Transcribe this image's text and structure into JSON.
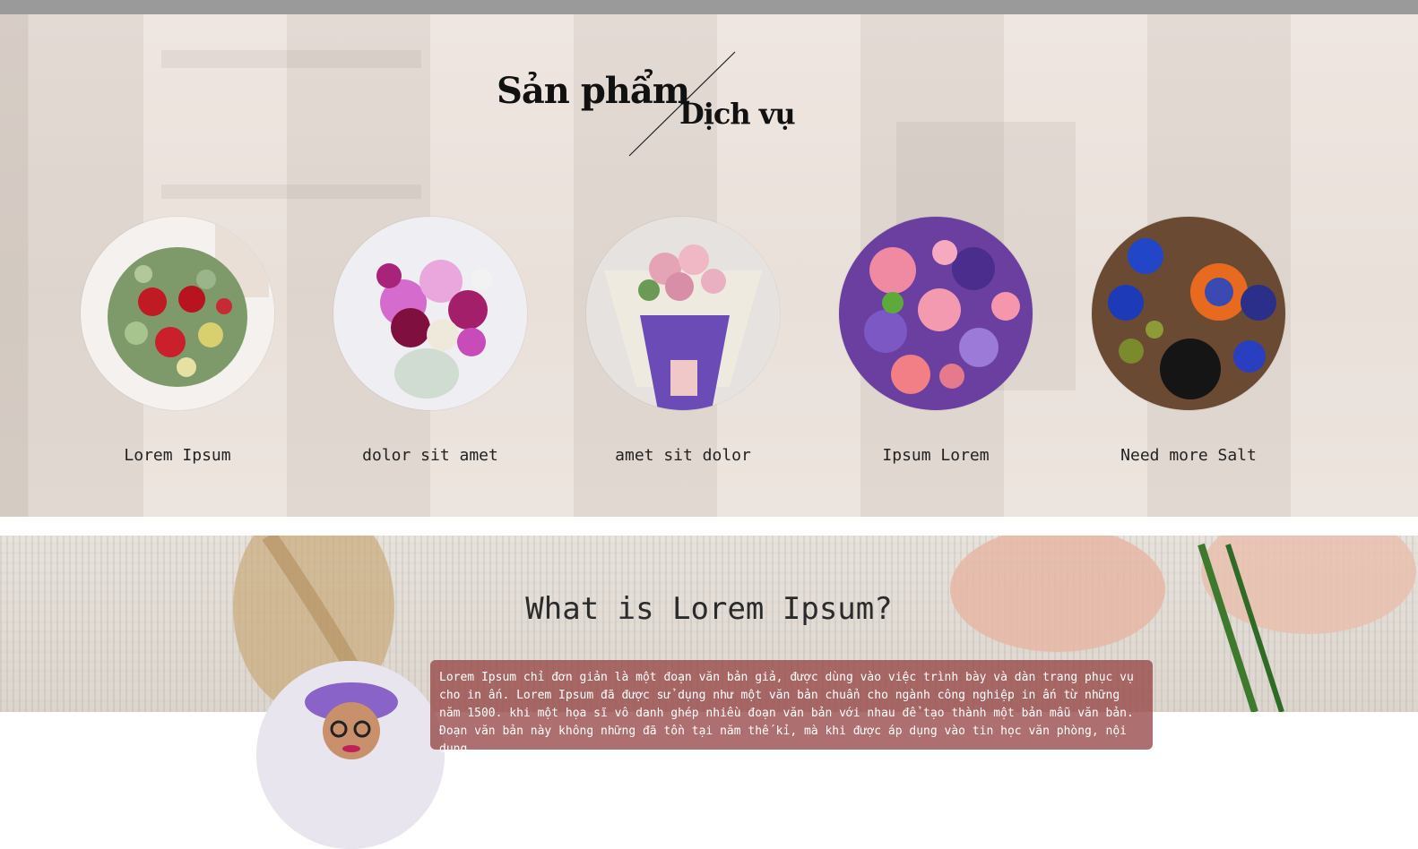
{
  "products_section": {
    "title_main": "Sản phẩm",
    "title_sub": "Dịch vụ",
    "items": [
      {
        "label": "Lorem Ipsum"
      },
      {
        "label": "dolor sit amet"
      },
      {
        "label": "amet sit dolor"
      },
      {
        "label": "Ipsum Lorem"
      },
      {
        "label": "Need more Salt"
      }
    ]
  },
  "about_section": {
    "title": "What is Lorem Ipsum?",
    "text": "Lorem Ipsum chỉ đơn giản là một đoạn văn bản giả, được dùng vào việc trình bày và dàn trang phục vụ cho in ấn. Lorem Ipsum đã được sử dụng như một văn bản chuẩn cho ngành công nghiệp in ấn từ những năm 1500. khi một họa sĩ vô danh ghép nhiều đoạn văn bản với nhau để tạo thành một bản mẫu văn bản. Đoạn văn bản này không những đã tồn tại năm thế kỉ, mà khi được áp dụng vào tin học văn phòng, nội dung"
  },
  "colors": {
    "topbar": "#9a9a9a",
    "text_box": "#964646"
  }
}
